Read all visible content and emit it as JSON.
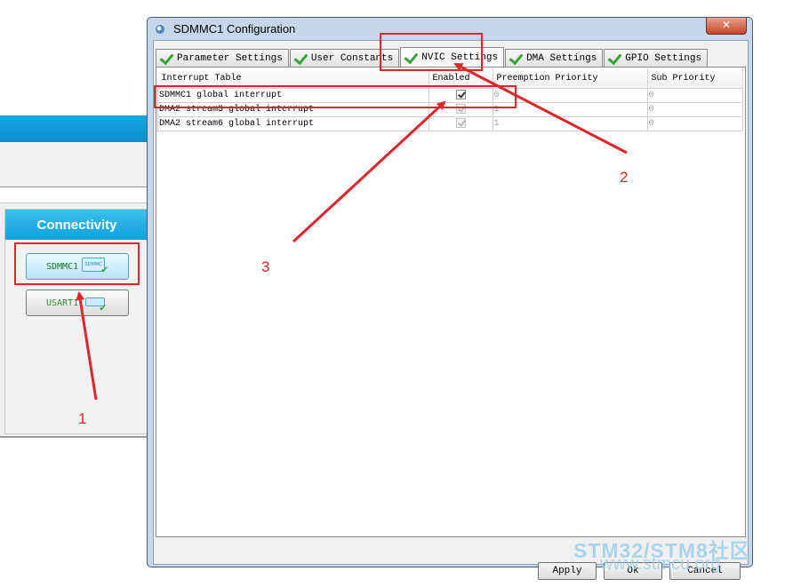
{
  "background": {
    "section_title": "Connectivity",
    "peripherals": [
      {
        "label": "SDMMC1",
        "chip_text": "SDMMC",
        "selected": true
      },
      {
        "label": "USART1",
        "chip_text": "",
        "selected": false
      }
    ]
  },
  "dialog": {
    "title": "SDMMC1 Configuration",
    "close_glyph": "✕",
    "tabs": [
      {
        "label": "Parameter Settings",
        "active": false
      },
      {
        "label": "User Constants",
        "active": false
      },
      {
        "label": "NVIC Settings",
        "active": true
      },
      {
        "label": "DMA Settings",
        "active": false
      },
      {
        "label": "GPIO Settings",
        "active": false
      }
    ],
    "table": {
      "columns": [
        "Interrupt Table",
        "Enabled",
        "Preemption Priority",
        "Sub Priority"
      ],
      "rows": [
        {
          "name": "SDMMC1 global interrupt",
          "enabled": true,
          "editable": true,
          "preemption": "0",
          "sub": "0"
        },
        {
          "name": "DMA2 stream3 global interrupt",
          "enabled": true,
          "editable": false,
          "preemption": "1",
          "sub": "0"
        },
        {
          "name": "DMA2 stream6 global interrupt",
          "enabled": true,
          "editable": false,
          "preemption": "1",
          "sub": "0"
        }
      ]
    },
    "buttons": {
      "apply": "Apply",
      "ok": "Ok",
      "cancel": "Cancel"
    }
  },
  "annotations": {
    "step1": "1",
    "step2": "2",
    "step3": "3",
    "color": "#e0252c"
  },
  "watermark": {
    "line1": "STM32/STM8社区",
    "line2": "www.stmcu.org"
  }
}
